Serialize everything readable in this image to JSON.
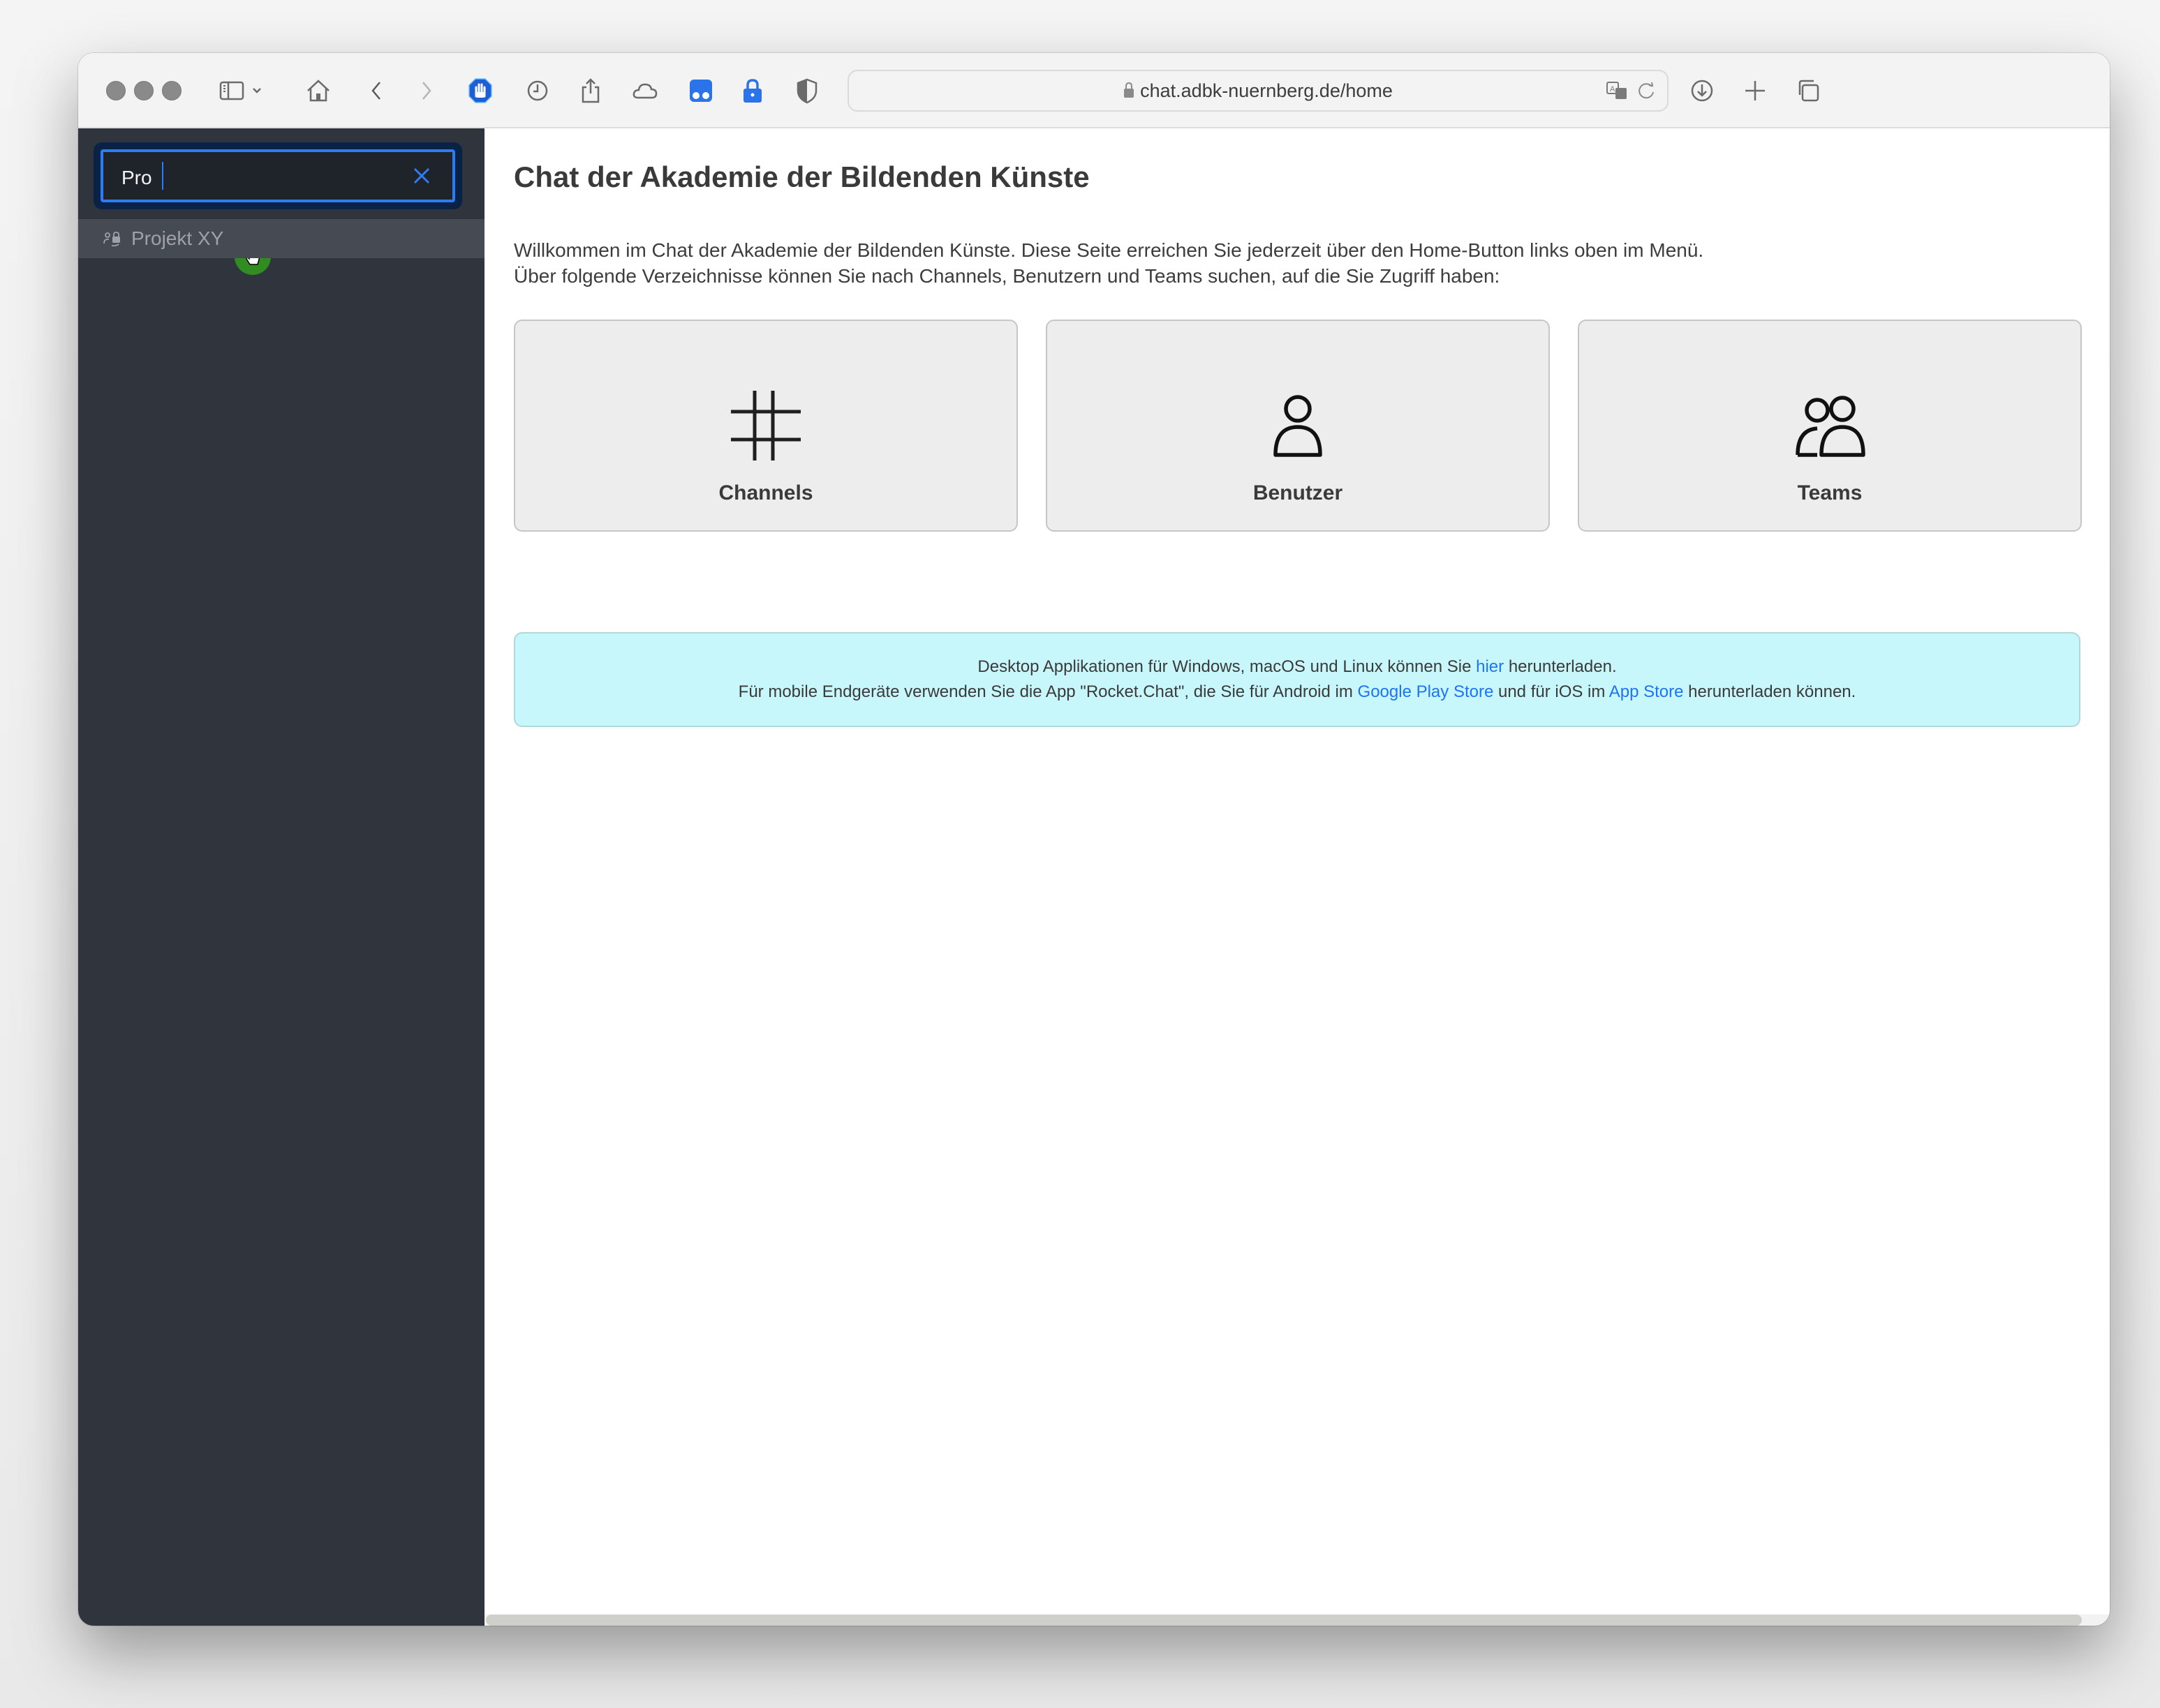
{
  "browser": {
    "url": "chat.adbk-nuernberg.de/home",
    "toolbar_icons": [
      "sidebar-icon",
      "chevron-down-icon",
      "home-icon",
      "back-icon",
      "forward-icon",
      "stop-hand-extension-icon",
      "history-icon",
      "share-icon",
      "icloud-icon",
      "extension-icon",
      "password-lock-icon",
      "privacy-shield-icon"
    ],
    "right_icons": [
      "translate-icon",
      "reload-icon",
      "downloads-icon",
      "new-tab-icon",
      "tab-overview-icon"
    ]
  },
  "sidebar": {
    "search": {
      "value": "Pro",
      "placeholder": ""
    },
    "results": [
      {
        "label": "Projekt XY",
        "icon": "team-private-icon"
      }
    ]
  },
  "main": {
    "title": "Chat der Akademie der Bildenden Künste",
    "intro_line1": "Willkommen im Chat der Akademie der Bildenden Künste. Diese Seite erreichen Sie jederzeit über den Home-Button links oben im Menü.",
    "intro_line2": "Über folgende Verzeichnisse können Sie nach Channels, Benutzern und Teams suchen, auf die Sie Zugriff haben:",
    "cards": [
      {
        "label": "Channels",
        "icon": "hashtag-icon"
      },
      {
        "label": "Benutzer",
        "icon": "user-icon"
      },
      {
        "label": "Teams",
        "icon": "team-icon"
      }
    ],
    "info": {
      "line1_pre": "Desktop Applikationen für Windows, macOS und Linux können Sie ",
      "line1_link": "hier",
      "line1_post": " herunterladen.",
      "line2_pre": "Für mobile Endgeräte verwenden Sie die App \"Rocket.Chat\", die Sie für Android im ",
      "line2_link1": "Google Play Store",
      "line2_mid": " und für iOS im ",
      "line2_link2": "App Store",
      "line2_post": " herunterladen können."
    }
  },
  "colors": {
    "sidebar_bg": "#2f343d",
    "accent": "#1d74f5",
    "info_bg": "#c8f7fb"
  }
}
